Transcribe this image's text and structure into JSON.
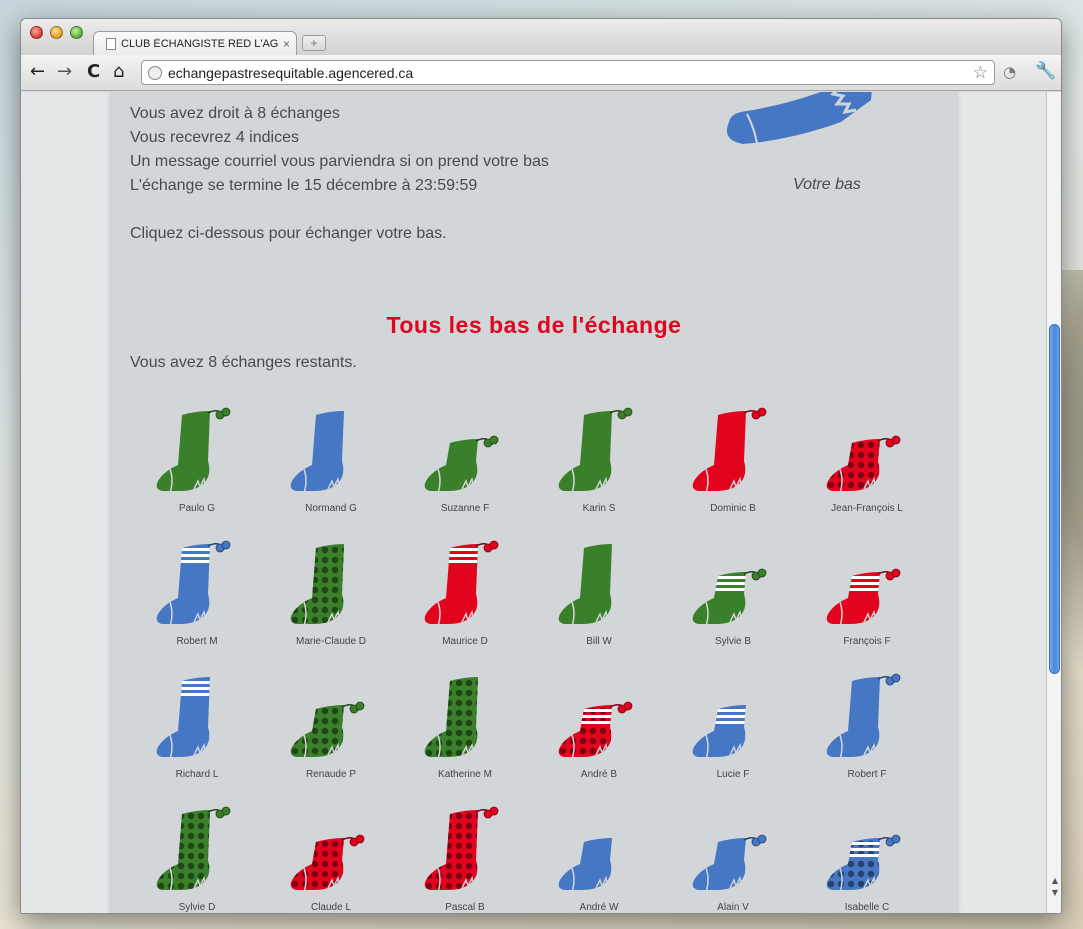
{
  "browser": {
    "tab_title": "CLUB ÉCHANGISTE RED L'AGENCE",
    "tab_close": "×",
    "new_tab": "+",
    "url": "echangepastresequitable.agencered.ca",
    "nav": {
      "back": "←",
      "forward": "→",
      "reload": "C",
      "home": "⌂"
    },
    "star": "☆",
    "extension": "◔",
    "menu": "🔧"
  },
  "info": {
    "lines": [
      "Vous avez droit à 8 échanges",
      "Vous recevrez 4 indices",
      "Un message courriel vous parviendra si on prend votre bas",
      "L'échange se termine le 15 décembre à 23:59:59"
    ],
    "cta": "Cliquez ci-dessous pour échanger votre bas."
  },
  "own_sock": {
    "label": "Votre bas",
    "color": "#4577c4"
  },
  "section_title": "Tous les bas de l'échange",
  "remaining": "Vous avez 8 échanges restants.",
  "colors": {
    "green": "#3a7f29",
    "blue": "#4577c4",
    "red": "#e2041e",
    "title": "#e2041e"
  },
  "stockings": [
    {
      "name": "Paulo G",
      "color": "green",
      "pattern": "plain",
      "pompom": true,
      "size": "tall"
    },
    {
      "name": "Normand G",
      "color": "blue",
      "pattern": "plain",
      "pompom": false,
      "size": "tall"
    },
    {
      "name": "Suzanne F",
      "color": "green",
      "pattern": "plain",
      "pompom": true,
      "size": "short"
    },
    {
      "name": "Karin S",
      "color": "green",
      "pattern": "plain",
      "pompom": true,
      "size": "tall"
    },
    {
      "name": "Dominic B",
      "color": "red",
      "pattern": "plain",
      "pompom": true,
      "size": "tall"
    },
    {
      "name": "Jean-François L",
      "color": "red",
      "pattern": "dots",
      "pompom": true,
      "size": "short"
    },
    {
      "name": "Robert M",
      "color": "blue",
      "pattern": "stripes",
      "pompom": true,
      "size": "tall"
    },
    {
      "name": "Marie-Claude D",
      "color": "green",
      "pattern": "dots",
      "pompom": false,
      "size": "tall"
    },
    {
      "name": "Maurice D",
      "color": "red",
      "pattern": "stripes",
      "pompom": true,
      "size": "tall"
    },
    {
      "name": "Bill W",
      "color": "green",
      "pattern": "plain",
      "pompom": false,
      "size": "tall"
    },
    {
      "name": "Sylvie B",
      "color": "green",
      "pattern": "stripes",
      "pompom": true,
      "size": "short"
    },
    {
      "name": "François F",
      "color": "red",
      "pattern": "stripes",
      "pompom": true,
      "size": "short"
    },
    {
      "name": "Richard L",
      "color": "blue",
      "pattern": "stripes",
      "pompom": false,
      "size": "tall"
    },
    {
      "name": "Renaude P",
      "color": "green",
      "pattern": "dots",
      "pompom": true,
      "size": "short"
    },
    {
      "name": "Katherine M",
      "color": "green",
      "pattern": "dots",
      "pompom": false,
      "size": "tall"
    },
    {
      "name": "André B",
      "color": "red",
      "pattern": "dots-stripes",
      "pompom": true,
      "size": "short"
    },
    {
      "name": "Lucie F",
      "color": "blue",
      "pattern": "stripes",
      "pompom": false,
      "size": "short"
    },
    {
      "name": "Robert F",
      "color": "blue",
      "pattern": "plain",
      "pompom": true,
      "size": "tall"
    },
    {
      "name": "Sylvie D",
      "color": "green",
      "pattern": "dots",
      "pompom": true,
      "size": "tall"
    },
    {
      "name": "Claude L",
      "color": "red",
      "pattern": "dots",
      "pompom": true,
      "size": "short"
    },
    {
      "name": "Pascal B",
      "color": "red",
      "pattern": "dots",
      "pompom": true,
      "size": "tall"
    },
    {
      "name": "André W",
      "color": "blue",
      "pattern": "plain",
      "pompom": false,
      "size": "short"
    },
    {
      "name": "Alain V",
      "color": "blue",
      "pattern": "plain",
      "pompom": true,
      "size": "short"
    },
    {
      "name": "Isabelle C",
      "color": "blue",
      "pattern": "dots-stripes",
      "pompom": true,
      "size": "short"
    }
  ]
}
